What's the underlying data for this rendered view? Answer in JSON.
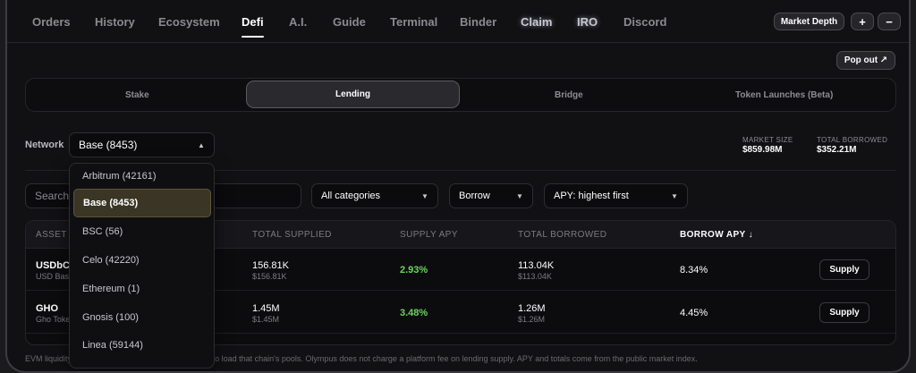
{
  "nav": {
    "tabs": [
      {
        "label": "Orders"
      },
      {
        "label": "History"
      },
      {
        "label": "Ecosystem"
      },
      {
        "label": "Defi"
      },
      {
        "label": "A.I."
      },
      {
        "label": "Guide"
      },
      {
        "label": "Terminal"
      },
      {
        "label": "Binder"
      },
      {
        "label": "Claim"
      },
      {
        "label": "IRO"
      },
      {
        "label": "Discord"
      }
    ],
    "active_tab": "Defi",
    "market_depth_label": "Market Depth",
    "plus_label": "+",
    "minus_label": "−"
  },
  "popout_label": "Pop out ↗",
  "segments": [
    {
      "label": "Stake"
    },
    {
      "label": "Lending"
    },
    {
      "label": "Bridge"
    },
    {
      "label": "Token Launches (Beta)"
    }
  ],
  "network": {
    "label": "Network",
    "selected": "Base (8453)",
    "caret": "▲",
    "options": [
      {
        "label": "Arbitrum (42161)"
      },
      {
        "label": "Base (8453)"
      },
      {
        "label": "BSC (56)"
      },
      {
        "label": "Celo (42220)"
      },
      {
        "label": "Ethereum (1)"
      },
      {
        "label": "Gnosis (100)"
      },
      {
        "label": "Linea (59144)"
      }
    ]
  },
  "stats": {
    "market_size_label": "MARKET SIZE",
    "market_size_value": "$859.98M",
    "total_borrowed_label": "TOTAL BORROWED",
    "total_borrowed_value": "$352.21M"
  },
  "filters": {
    "search_placeholder": "Search",
    "category": "All categories",
    "mode": "Borrow",
    "sort": "APY: highest first",
    "caret": "▼"
  },
  "table": {
    "headers": {
      "asset": "ASSET",
      "total_supplied": "TOTAL SUPPLIED",
      "supply_apy": "SUPPLY APY",
      "total_borrowed": "TOTAL BORROWED",
      "borrow_apy": "BORROW APY ↓"
    },
    "rows": [
      {
        "symbol": "USDbC",
        "name": "USD Base Coin",
        "supplied": "156.81K",
        "supplied_usd": "$156.81K",
        "supply_apy": "2.93%",
        "borrowed": "113.04K",
        "borrowed_usd": "$113.04K",
        "borrow_apy": "8.34%",
        "action": "Supply"
      },
      {
        "symbol": "GHO",
        "name": "Gho Token",
        "supplied": "1.45M",
        "supplied_usd": "$1.45M",
        "supply_apy": "3.48%",
        "borrowed": "1.26M",
        "borrowed_usd": "$1.26M",
        "borrow_apy": "4.45%",
        "action": "Supply"
      }
    ]
  },
  "footnote": "EVM liquidity is pulled per network; select a network to load that chain's pools. Olympus does not charge a platform fee on lending supply. APY and totals come from the public market index.",
  "colors": {
    "positive": "#6bd45c",
    "selected_option_bg": "#3a3524"
  }
}
